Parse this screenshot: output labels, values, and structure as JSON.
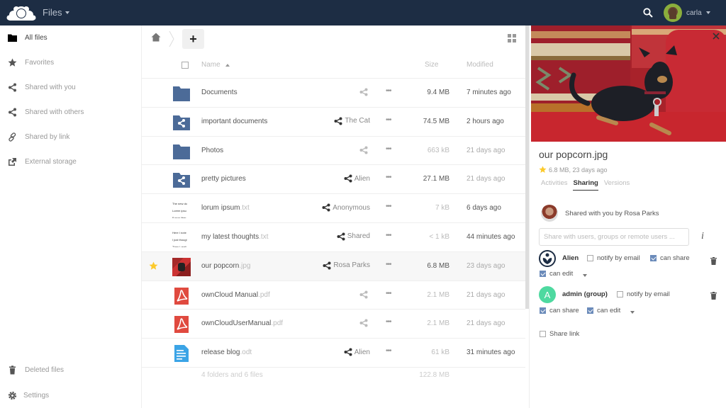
{
  "header": {
    "app_title": "Files",
    "user_name": "carla",
    "colors": {
      "bar": "#1d2d44"
    }
  },
  "nav": {
    "items": [
      {
        "label": "All files",
        "icon": "folder-icon",
        "active": true
      },
      {
        "label": "Favorites",
        "icon": "star-icon"
      },
      {
        "label": "Shared with you",
        "icon": "share-icon"
      },
      {
        "label": "Shared with others",
        "icon": "share-icon"
      },
      {
        "label": "Shared by link",
        "icon": "link-icon"
      },
      {
        "label": "External storage",
        "icon": "external-storage-icon"
      }
    ],
    "bottom": [
      {
        "label": "Deleted files",
        "icon": "trash-icon"
      },
      {
        "label": "Settings",
        "icon": "gear-icon"
      }
    ]
  },
  "files": {
    "new_button": "+",
    "columns": {
      "name": "Name",
      "size": "Size",
      "modified": "Modified"
    },
    "rows": [
      {
        "name": "Documents",
        "ext": "",
        "type": "folder",
        "share": "",
        "shared": false,
        "size": "9.4 MB",
        "modified": "7 minutes ago",
        "favorite": false
      },
      {
        "name": "important documents",
        "ext": "",
        "type": "shared-folder",
        "share": "The Cat",
        "shared": true,
        "size": "74.5 MB",
        "modified": "2 hours ago",
        "favorite": false
      },
      {
        "name": "Photos",
        "ext": "",
        "type": "folder",
        "share": "",
        "shared": false,
        "size": "663 kB",
        "modified": "21 days ago",
        "favorite": false
      },
      {
        "name": "pretty pictures",
        "ext": "",
        "type": "shared-folder",
        "share": "Alien",
        "shared": true,
        "size": "27.1 MB",
        "modified": "21 days ago",
        "favorite": false
      },
      {
        "name": "lorum ipsum",
        "ext": ".txt",
        "type": "text",
        "thumb": [
          "The new do",
          "Lorem ipsu",
          "Fusce liber"
        ],
        "share": "Anonymous",
        "shared": true,
        "size": "7 kB",
        "modified": "6 days ago",
        "favorite": false
      },
      {
        "name": "my latest thoughts",
        "ext": ".txt",
        "type": "text",
        "thumb": [
          "Here I note",
          "I just thougl",
          "Then I reali"
        ],
        "share": "Shared",
        "shared": true,
        "size": "< 1 kB",
        "modified": "44 minutes ago",
        "favorite": false
      },
      {
        "name": "our popcorn",
        "ext": ".jpg",
        "type": "image",
        "share": "Rosa Parks",
        "shared": true,
        "size": "6.8 MB",
        "modified": "23 days ago",
        "favorite": true,
        "selected": true
      },
      {
        "name": "ownCloud Manual",
        "ext": ".pdf",
        "type": "pdf",
        "share": "",
        "shared": false,
        "size": "2.1 MB",
        "modified": "21 days ago",
        "favorite": false
      },
      {
        "name": "ownCloudUserManual",
        "ext": ".pdf",
        "type": "pdf",
        "share": "",
        "shared": false,
        "size": "2.1 MB",
        "modified": "21 days ago",
        "favorite": false
      },
      {
        "name": "release blog",
        "ext": ".odt",
        "type": "document",
        "share": "Alien",
        "shared": true,
        "size": "61 kB",
        "modified": "31 minutes ago",
        "favorite": false
      }
    ],
    "summary": {
      "text": "4 folders and 6 files",
      "size": "122.8 MB"
    }
  },
  "details": {
    "title": "our popcorn.jpg",
    "meta": "6.8 MB, 23 days ago",
    "favorite": true,
    "tabs": [
      {
        "label": "Activities",
        "active": false
      },
      {
        "label": "Sharing",
        "active": true
      },
      {
        "label": "Versions",
        "active": false
      }
    ],
    "shared_by": "Shared with you by Rosa Parks",
    "share_input_placeholder": "Share with users, groups or remote users ...",
    "info_label": "i",
    "sharees": [
      {
        "name": "Alien",
        "notify_label": "notify by email",
        "notify": false,
        "can_share_label": "can share",
        "can_share": true,
        "can_edit_label": "can edit",
        "can_edit": true
      },
      {
        "name": "admin (group)",
        "avatar_letter": "A",
        "notify_label": "notify by email",
        "notify": false,
        "can_share_label": "can share",
        "can_share": true,
        "can_edit_label": "can edit",
        "can_edit": true
      }
    ],
    "share_link_label": "Share link",
    "share_link": false
  }
}
